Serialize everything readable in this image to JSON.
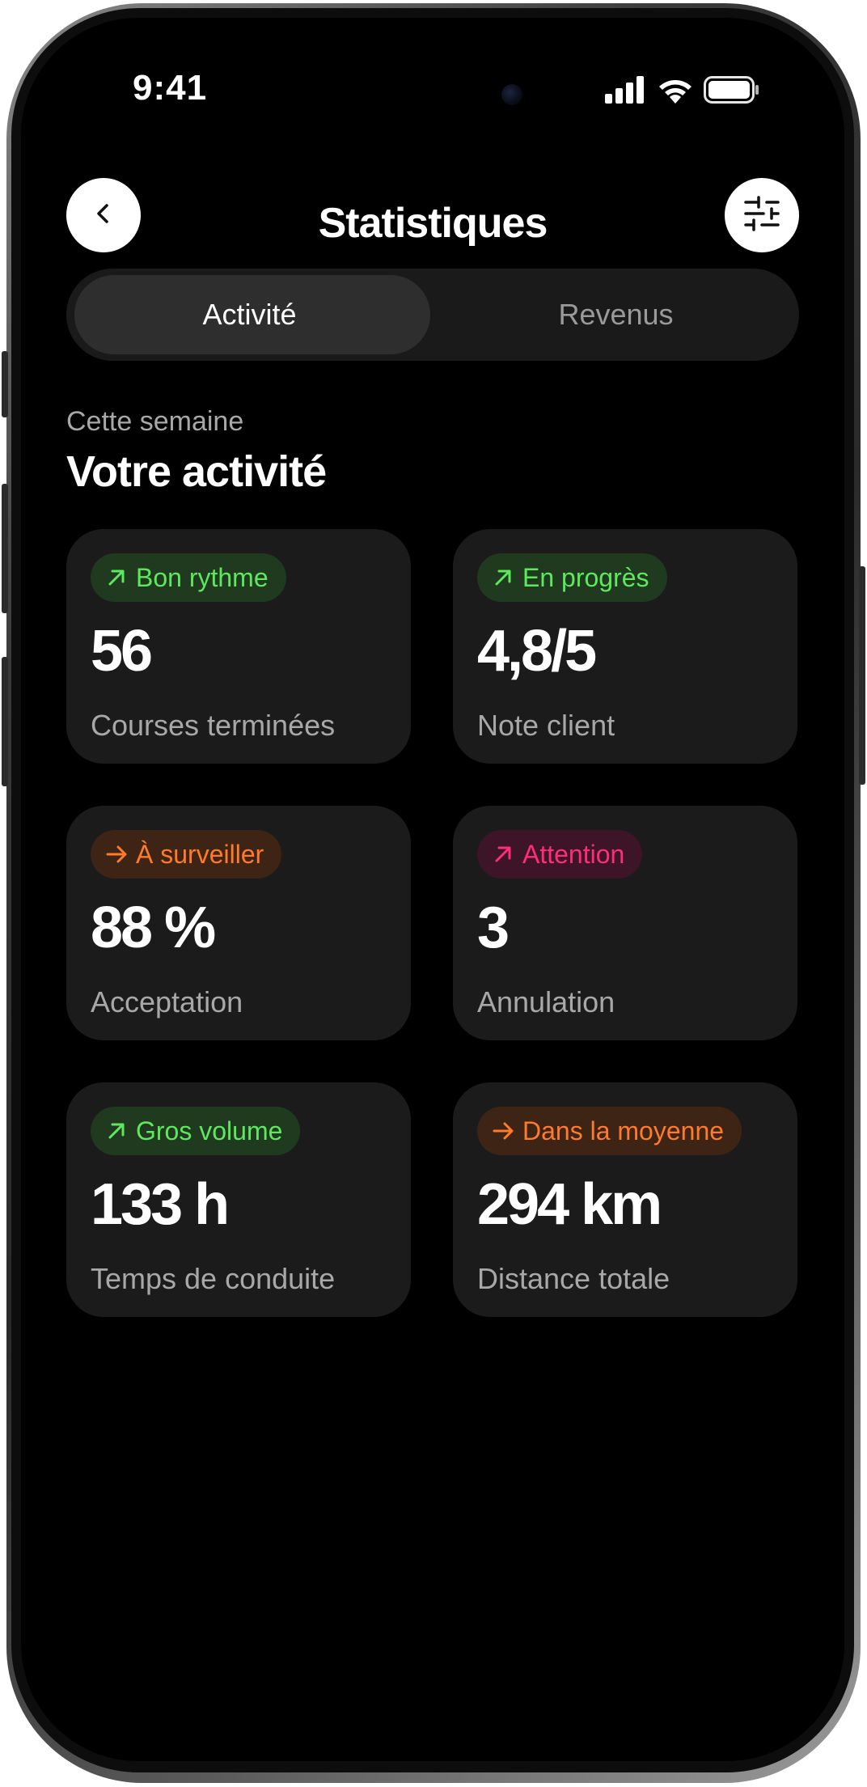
{
  "status_bar": {
    "time": "9:41"
  },
  "header": {
    "title": "Statistiques",
    "back_icon": "chevron-left-icon",
    "filter_icon": "sliders-icon"
  },
  "tabs": [
    {
      "label": "Activité",
      "active": true
    },
    {
      "label": "Revenus",
      "active": false
    }
  ],
  "section": {
    "subtitle": "Cette semaine",
    "title": "Votre activité"
  },
  "colors": {
    "green": "#5ee85e",
    "green_bg": "#1f3a1f",
    "orange": "#ff7a2a",
    "orange_bg": "#3d2414",
    "pink": "#ff2d78",
    "pink_bg": "#3d1428",
    "card_bg": "#1b1b1b"
  },
  "cards": [
    {
      "badge": "Bon rythme",
      "badge_icon": "arrow-up-right-icon",
      "tone": "green",
      "value": "56",
      "label": "Courses terminées"
    },
    {
      "badge": "En progrès",
      "badge_icon": "arrow-up-right-icon",
      "tone": "green",
      "value": "4,8/5",
      "label": "Note client"
    },
    {
      "badge": "À surveiller",
      "badge_icon": "arrow-right-icon",
      "tone": "orange",
      "value": "88 %",
      "label": "Acceptation"
    },
    {
      "badge": "Attention",
      "badge_icon": "arrow-up-right-icon",
      "tone": "pink",
      "value": "3",
      "label": "Annulation"
    },
    {
      "badge": "Gros volume",
      "badge_icon": "arrow-up-right-icon",
      "tone": "green",
      "value": "133 h",
      "label": "Temps de conduite"
    },
    {
      "badge": "Dans la moyenne",
      "badge_icon": "arrow-right-icon",
      "tone": "orange",
      "value": "294 km",
      "label": "Distance totale"
    }
  ]
}
